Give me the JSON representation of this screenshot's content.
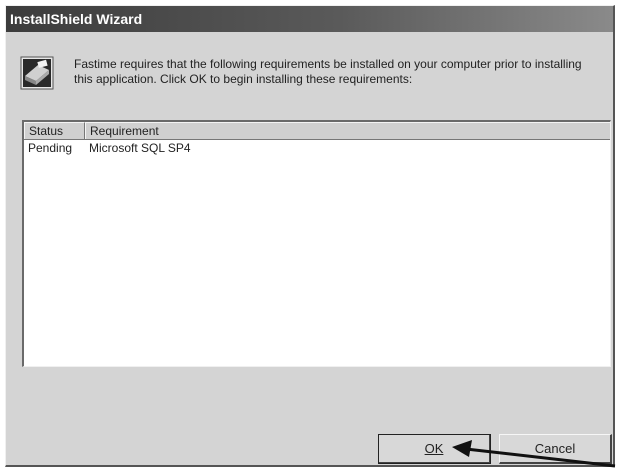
{
  "window": {
    "title": "InstallShield Wizard"
  },
  "message": {
    "text": "Fastime requires that the following requirements be installed on your computer prior to installing this application. Click OK to begin installing these requirements:",
    "icon": "installer-icon"
  },
  "requirements": {
    "columns": [
      "Status",
      "Requirement"
    ],
    "rows": [
      {
        "status": "Pending",
        "requirement": "Microsoft SQL SP4"
      }
    ]
  },
  "buttons": {
    "ok_label": "OK",
    "cancel_label": "Cancel"
  },
  "annotation": {
    "icon": "pointer-arrow"
  }
}
